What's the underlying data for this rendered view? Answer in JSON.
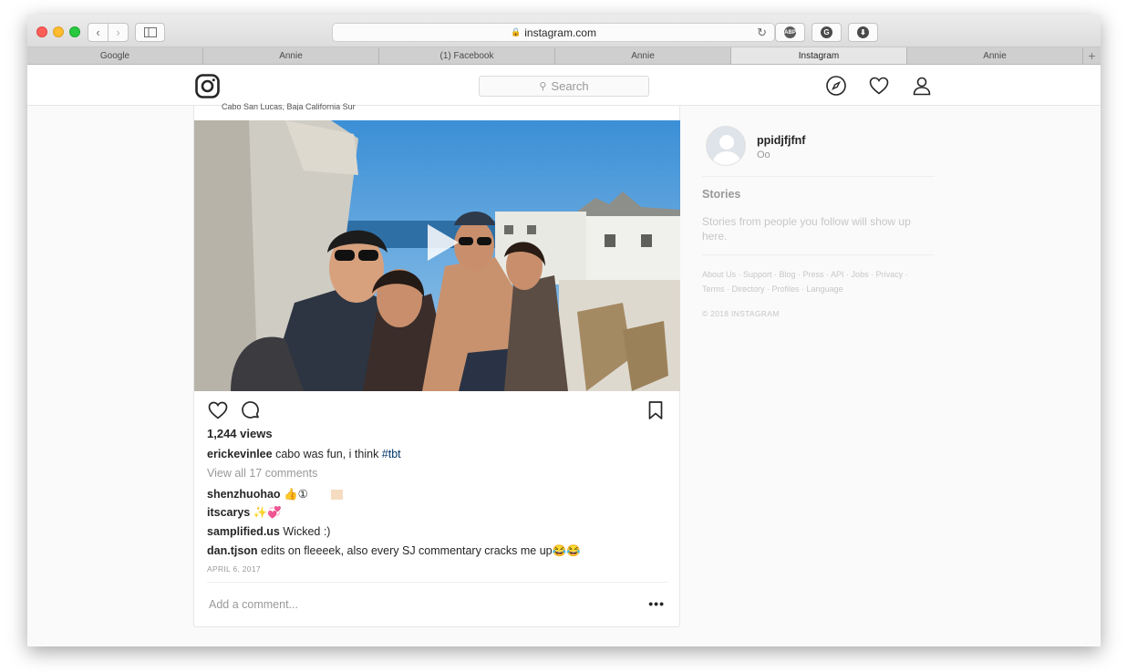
{
  "browser": {
    "url": "instagram.com",
    "extensions": [
      "ABP",
      "G",
      "⬇"
    ],
    "tabs": [
      {
        "label": "Google",
        "active": false
      },
      {
        "label": "Annie",
        "active": false
      },
      {
        "label": "(1) Facebook",
        "active": false
      },
      {
        "label": "Annie",
        "active": false
      },
      {
        "label": "Instagram",
        "active": true
      },
      {
        "label": "Annie",
        "active": false
      }
    ],
    "new_tab": "+"
  },
  "header": {
    "search_placeholder": "Search",
    "icons": [
      "instagram-logo-icon",
      "compass-icon",
      "heart-icon",
      "profile-icon"
    ]
  },
  "post": {
    "location": "Cabo San Lucas, Baja California Sur",
    "views": "1,244 views",
    "caption": {
      "user": "erickevinlee",
      "text": " cabo was fun, i think ",
      "hashtag": "#tbt"
    },
    "view_all": "View all 17 comments",
    "comments": [
      {
        "user": "shenzhuohao",
        "text": " 👍①"
      },
      {
        "user": "itscarys",
        "text": " ✨💞"
      },
      {
        "user": "samplified.us",
        "text": " Wicked :)"
      },
      {
        "user": "dan.tjson",
        "text": " edits on fleeeek, also every SJ commentary cracks me up😂😂"
      }
    ],
    "date": "APRIL 6, 2017",
    "add_comment_placeholder": "Add a comment...",
    "more": "•••"
  },
  "sidebar": {
    "username": "ppidjfjfnf",
    "fullname": "Oo",
    "stories_heading": "Stories",
    "stories_text": "Stories from people you follow will show up here.",
    "links": "About Us · Support · Blog · Press · API · Jobs · Privacy · Terms · Directory · Profiles · Language",
    "copyright": "© 2018 INSTAGRAM"
  }
}
